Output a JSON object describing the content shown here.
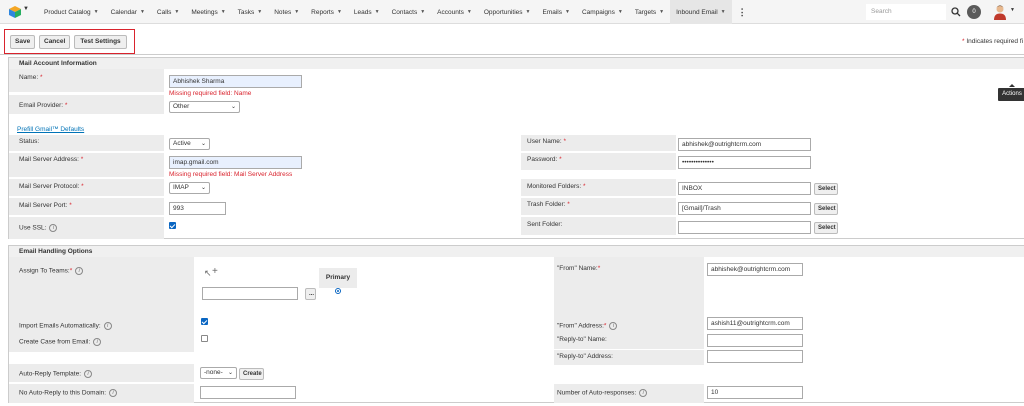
{
  "nav": {
    "items": [
      {
        "label": "Product Catalog"
      },
      {
        "label": "Calendar"
      },
      {
        "label": "Calls"
      },
      {
        "label": "Meetings"
      },
      {
        "label": "Tasks"
      },
      {
        "label": "Notes"
      },
      {
        "label": "Reports"
      },
      {
        "label": "Leads"
      },
      {
        "label": "Contacts"
      },
      {
        "label": "Accounts"
      },
      {
        "label": "Opportunities"
      },
      {
        "label": "Emails"
      },
      {
        "label": "Campaigns"
      },
      {
        "label": "Targets"
      },
      {
        "label": "Inbound Email"
      }
    ],
    "search_placeholder": "Search",
    "notification_count": "0"
  },
  "toolbar": {
    "save_label": "Save",
    "cancel_label": "Cancel",
    "test_label": "Test Settings",
    "required_note": "Indicates required fi",
    "required_star": "*",
    "actions_tooltip": "Actions"
  },
  "mail_account": {
    "header": "Mail Account Information",
    "name_label": "Name:",
    "name_value": "Abhishek Sharma",
    "name_error": "Missing required field: Name",
    "provider_label": "Email Provider:",
    "provider_value": "Other",
    "prefill_link": "Prefill Gmail™ Defaults",
    "status_label": "Status:",
    "status_value": "Active",
    "server_label": "Mail Server Address:",
    "server_value": "imap.gmail.com",
    "server_error": "Missing required field: Mail Server Address",
    "protocol_label": "Mail Server Protocol:",
    "protocol_value": "IMAP",
    "port_label": "Mail Server Port:",
    "port_value": "993",
    "ssl_label": "Use SSL:",
    "ssl_checked": true,
    "username_label": "User Name:",
    "username_value": "abhishek@outrightcrm.com",
    "password_label": "Password:",
    "password_value": "••••••••••••••",
    "monitored_label": "Monitored Folders:",
    "monitored_value": "INBOX",
    "trash_label": "Trash Folder:",
    "trash_value": "[Gmail]/Trash",
    "sent_label": "Sent Folder:",
    "sent_value": "",
    "select_label": "Select"
  },
  "email_handling": {
    "header": "Email Handling Options",
    "assign_label": "Assign To Teams:",
    "primary_label": "Primary",
    "team_value": "",
    "team_btn": "...",
    "import_label": "Import Emails Automatically:",
    "import_checked": true,
    "create_case_label": "Create Case from Email:",
    "create_case_checked": false,
    "auto_reply_label": "Auto-Reply Template:",
    "auto_reply_value": "-none-",
    "create_btn": "Create",
    "no_auto_reply_label": "No Auto-Reply to this Domain:",
    "no_auto_reply_value": "",
    "from_name_label": "\"From\" Name:",
    "from_name_value": "abhishek@outrightcrm.com",
    "from_address_label": "\"From\" Address:",
    "from_address_value": "ashish11@outrightcrm.com",
    "reply_to_name_label": "\"Reply-to\" Name:",
    "reply_to_name_value": "",
    "reply_to_address_label": "\"Reply-to\" Address:",
    "reply_to_address_value": "",
    "auto_responses_label": "Number of Auto-responses:",
    "auto_responses_value": "10"
  },
  "colors": {
    "accent": "#0a66c2",
    "error": "#d9232d",
    "link": "#0073b7"
  }
}
